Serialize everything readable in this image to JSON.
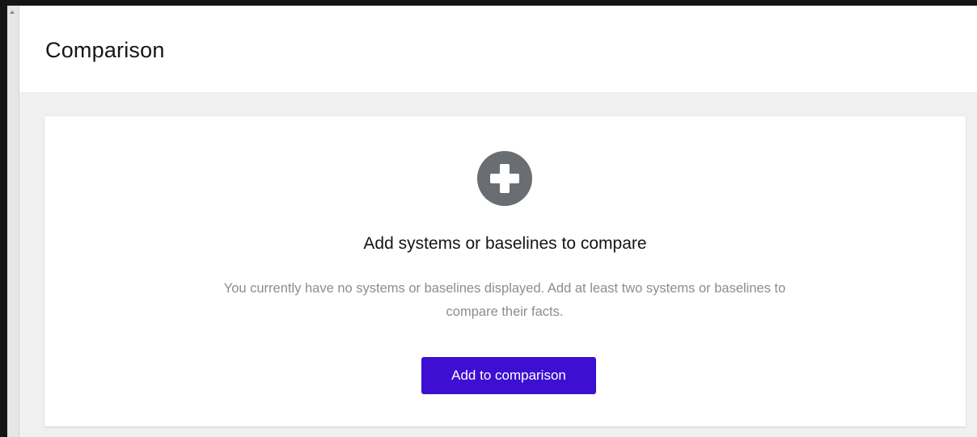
{
  "page": {
    "title": "Comparison"
  },
  "empty_state": {
    "icon": "plus-circle-icon",
    "title": "Add systems or baselines to compare",
    "body": "You currently have no systems or baselines displayed. Add at least two systems or baselines to compare their facts.",
    "action_label": "Add to comparison"
  },
  "colors": {
    "primary": "#3c0fd1",
    "icon": "#6a6e73",
    "body_text": "#8a8d90",
    "page_background": "#f0f0f0"
  }
}
